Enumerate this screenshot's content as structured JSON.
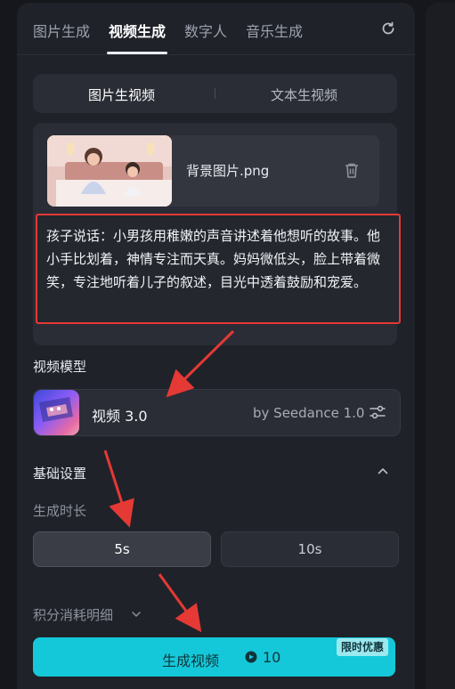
{
  "tabs": [
    {
      "label": "图片生成"
    },
    {
      "label": "视频生成"
    },
    {
      "label": "数字人"
    },
    {
      "label": "音乐生成"
    }
  ],
  "mode_switch": {
    "image_to_video": "图片生视频",
    "text_to_video": "文本生视频"
  },
  "upload": {
    "file_name": "背景图片.png"
  },
  "prompt": {
    "text": "孩子说话：小男孩用稚嫩的声音讲述着他想听的故事。他小手比划着，神情专注而天真。妈妈微低头，脸上带着微笑，专注地听着儿子的叙述，目光中透着鼓励和宠爱。"
  },
  "model": {
    "section_title": "视频模型",
    "name": "视频 3.0",
    "provider": "by Seedance 1.0"
  },
  "settings": {
    "section_title": "基础设置",
    "duration_label": "生成时长",
    "durations": [
      "5s",
      "10s"
    ],
    "selected_duration": "5s",
    "credits_detail": "积分消耗明细"
  },
  "generate": {
    "label": "生成视频",
    "cost": "10",
    "promo_badge": "限时优惠"
  },
  "colors": {
    "accent": "#14c8d9",
    "annotation": "#e53935"
  }
}
